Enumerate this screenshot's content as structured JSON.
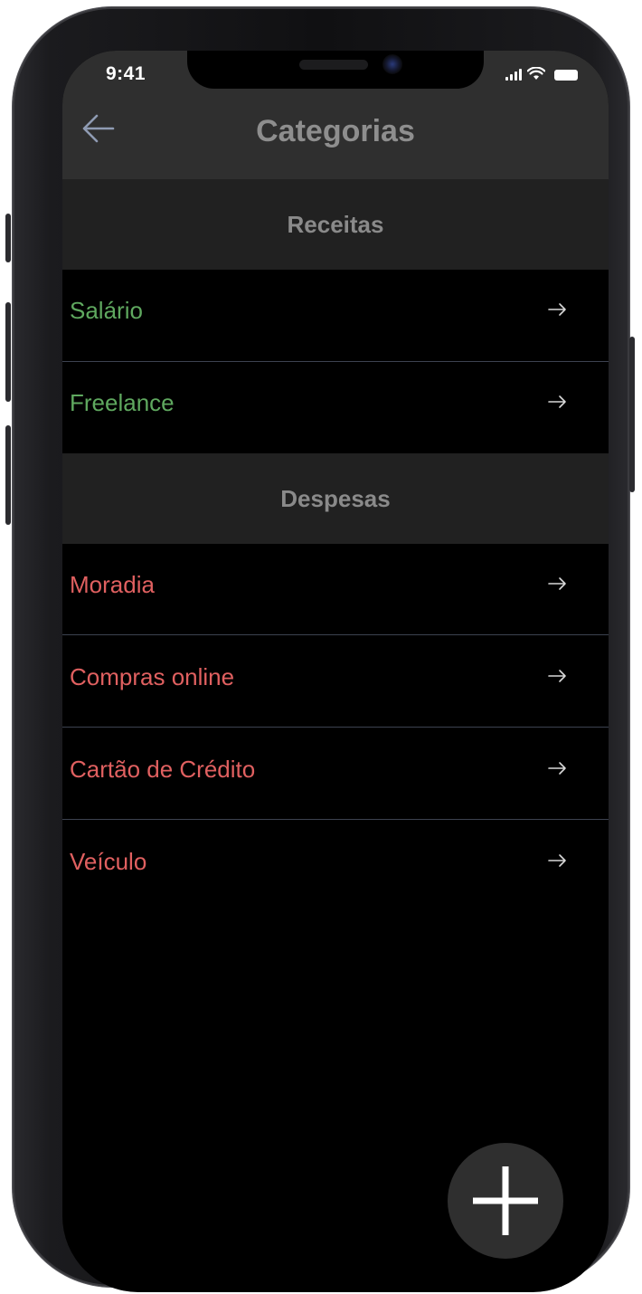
{
  "status_bar": {
    "time": "9:41",
    "icons": [
      "signal-icon",
      "wifi-icon",
      "battery-icon"
    ]
  },
  "header": {
    "title": "Categorias",
    "back_icon": "arrow-left-icon"
  },
  "sections": [
    {
      "title": "Receitas",
      "color": "#5fa85f",
      "items": [
        {
          "label": "Salário"
        },
        {
          "label": "Freelance"
        }
      ]
    },
    {
      "title": "Despesas",
      "color": "#e06060",
      "items": [
        {
          "label": "Moradia"
        },
        {
          "label": "Compras online"
        },
        {
          "label": "Cartão de Crédito"
        },
        {
          "label": "Veículo"
        }
      ]
    }
  ],
  "row_icon": "arrow-right-icon",
  "fab": {
    "icon": "plus-icon"
  },
  "colors": {
    "background": "#000000",
    "header": "#2f2f2f",
    "section_header": "#212121",
    "income": "#5fa85f",
    "expense": "#e06060"
  }
}
